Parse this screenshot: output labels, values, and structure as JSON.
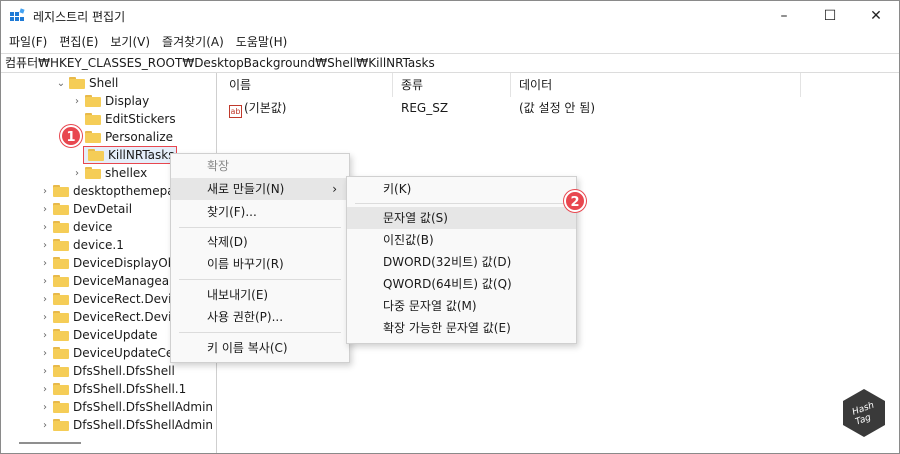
{
  "window": {
    "title": "레지스트리 편집기",
    "controls": {
      "minimize": "–",
      "maximize": "☐",
      "close": "✕"
    }
  },
  "menu": [
    "파일(F)",
    "편집(E)",
    "보기(V)",
    "즐겨찾기(A)",
    "도움말(H)"
  ],
  "address": "컴퓨터₩HKEY_CLASSES_ROOT₩DesktopBackground₩Shell₩KillNRTasks",
  "tree": {
    "items": [
      {
        "label": "Shell"
      },
      {
        "label": "Display"
      },
      {
        "label": "EditStickers"
      },
      {
        "label": "Personalize"
      },
      {
        "label": "KillNRTasks"
      },
      {
        "label": "shellex"
      },
      {
        "label": "desktopthemepac"
      },
      {
        "label": "DevDetail"
      },
      {
        "label": "device"
      },
      {
        "label": "device.1"
      },
      {
        "label": "DeviceDisplayObj"
      },
      {
        "label": "DeviceManageab"
      },
      {
        "label": "DeviceRect.Device"
      },
      {
        "label": "DeviceRect.Device"
      },
      {
        "label": "DeviceUpdate"
      },
      {
        "label": "DeviceUpdateCen"
      },
      {
        "label": "DfsShell.DfsShell"
      },
      {
        "label": "DfsShell.DfsShell.1"
      },
      {
        "label": "DfsShell.DfsShellAdmin"
      },
      {
        "label": "DfsShell.DfsShellAdmin"
      }
    ]
  },
  "list": {
    "columns": [
      "이름",
      "종류",
      "데이터"
    ],
    "rows": [
      {
        "icon": "ab",
        "name": "(기본값)",
        "type": "REG_SZ",
        "data": "(값 설정 안 됨)"
      }
    ]
  },
  "context_menu": {
    "header": "확장",
    "items": [
      "새로 만들기(N)",
      "찾기(F)...",
      "삭제(D)",
      "이름 바꾸기(R)",
      "내보내기(E)",
      "사용 권한(P)...",
      "키 이름 복사(C)"
    ]
  },
  "submenu": {
    "items": [
      "키(K)",
      "문자열 값(S)",
      "이진값(B)",
      "DWORD(32비트) 값(D)",
      "QWORD(64비트) 값(Q)",
      "다중 문자열 값(M)",
      "확장 가능한 문자열 값(E)"
    ]
  },
  "badges": [
    "1",
    "2"
  ],
  "watermark": {
    "line1": "Hash",
    "line2": "Tag"
  },
  "colors": {
    "highlight_border": "#e8474f",
    "folder": "#f5cd57",
    "menu_bg": "#f9f9f9"
  }
}
